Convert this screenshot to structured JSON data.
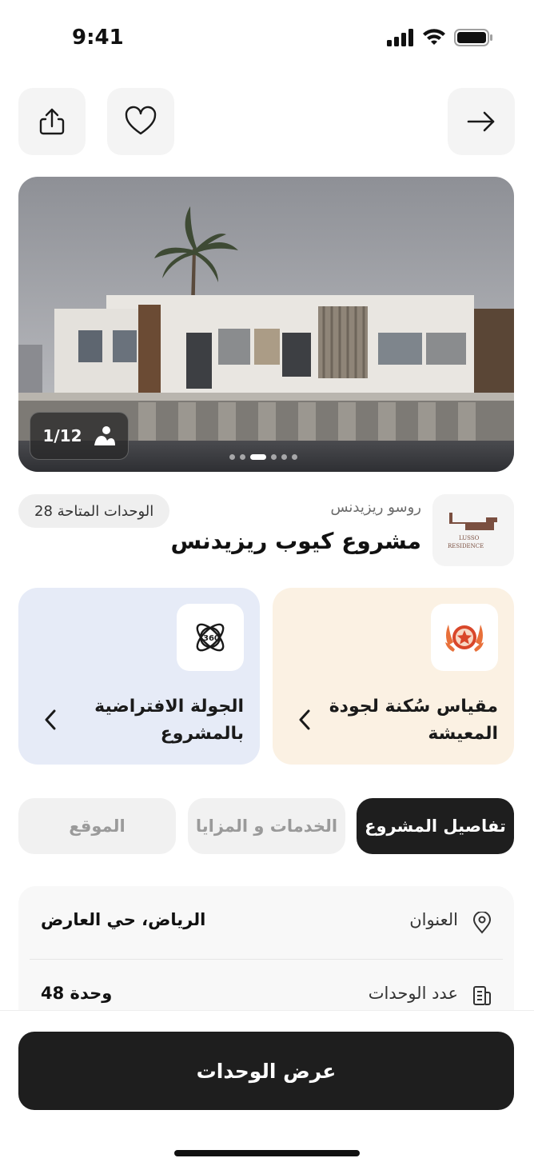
{
  "status_bar": {
    "time": "9:41"
  },
  "header": {
    "share_icon": "share-icon",
    "favorite_icon": "heart-icon",
    "back_icon": "arrow-right-icon"
  },
  "gallery": {
    "counter": "1/12",
    "counter_icon": "images-icon",
    "current_slide": 3,
    "total_dots": 6
  },
  "project": {
    "developer": "روسو ريزيدنس",
    "title": "مشروع كيوب ريزيدنس",
    "available_units": "الوحدات المتاحة 28",
    "logo_text_line1": "LUSSO",
    "logo_text_line2": "RESIDENCE"
  },
  "cards": [
    {
      "title": "مقياس سُكنة لجودة المعيشة",
      "icon": "award-star-icon"
    },
    {
      "title": "الجولة الافتراضية بالمشروع",
      "icon": "360-tour-icon"
    }
  ],
  "tabs": [
    {
      "label": "تفاصيل المشروع",
      "active": true
    },
    {
      "label": "الخدمات و المزايا",
      "active": false
    },
    {
      "label": "الموقع",
      "active": false
    }
  ],
  "details": [
    {
      "label": "العنوان",
      "value": "الرياض، حي العارض",
      "icon": "location-pin-icon"
    },
    {
      "label": "عدد الوحدات",
      "value": "48 وحدة",
      "icon": "building-icon"
    }
  ],
  "cta": {
    "label": "عرض الوحدات"
  },
  "colors": {
    "primary_dark": "#1e1e1e",
    "quality_card_bg": "#fbf1e3",
    "tour_card_bg": "#e6ebf7",
    "award_accent": "#e05a2b"
  }
}
